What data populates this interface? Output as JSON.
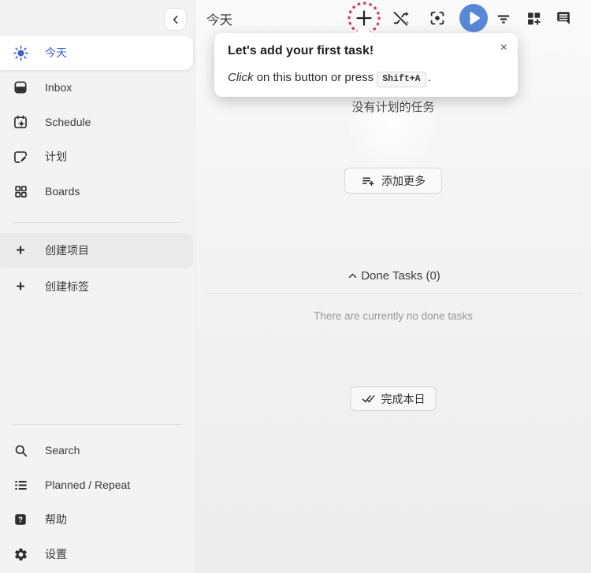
{
  "header": {
    "title": "今天"
  },
  "icons": {
    "plus": "+",
    "close": "×"
  },
  "colors": {
    "accent_blue": "#3e63c7",
    "play_blue": "#5988d8",
    "tutorial_pink": "#d23b6e",
    "sidebar_bg": "#f3f3f3"
  },
  "sidebar": {
    "items_top": [
      {
        "label": "今天",
        "icon": "sun-icon",
        "active": true
      },
      {
        "label": "Inbox",
        "icon": "inbox-icon"
      },
      {
        "label": "Schedule",
        "icon": "calendar-sun-icon"
      },
      {
        "label": "计划",
        "icon": "calendar-edit-icon"
      },
      {
        "label": "Boards",
        "icon": "grid-icon"
      }
    ],
    "items_create": [
      {
        "label": "创建项目",
        "icon": "plus-icon"
      },
      {
        "label": "创建标签",
        "icon": "plus-icon"
      }
    ],
    "items_bottom": [
      {
        "label": "Search",
        "icon": "search-icon"
      },
      {
        "label": "Planned / Repeat",
        "icon": "list-icon"
      },
      {
        "label": "帮助",
        "icon": "help-icon"
      },
      {
        "label": "设置",
        "icon": "gear-icon"
      }
    ]
  },
  "toolbar": {
    "icons": [
      "add-task",
      "shuffle-off",
      "focus-mode",
      "start-day-play",
      "filter",
      "add-widget",
      "comments"
    ]
  },
  "popover": {
    "title": "Let's add your first task!",
    "body_italic": "Click",
    "body_text": " on this button or press ",
    "kbd": "Shift+A",
    "body_suffix": "."
  },
  "main": {
    "empty_title": "没有计划的任务",
    "add_more": "添加更多",
    "done_header": "Done Tasks (0)",
    "done_empty": "There are currently no done tasks",
    "finish_day": "完成本日"
  }
}
